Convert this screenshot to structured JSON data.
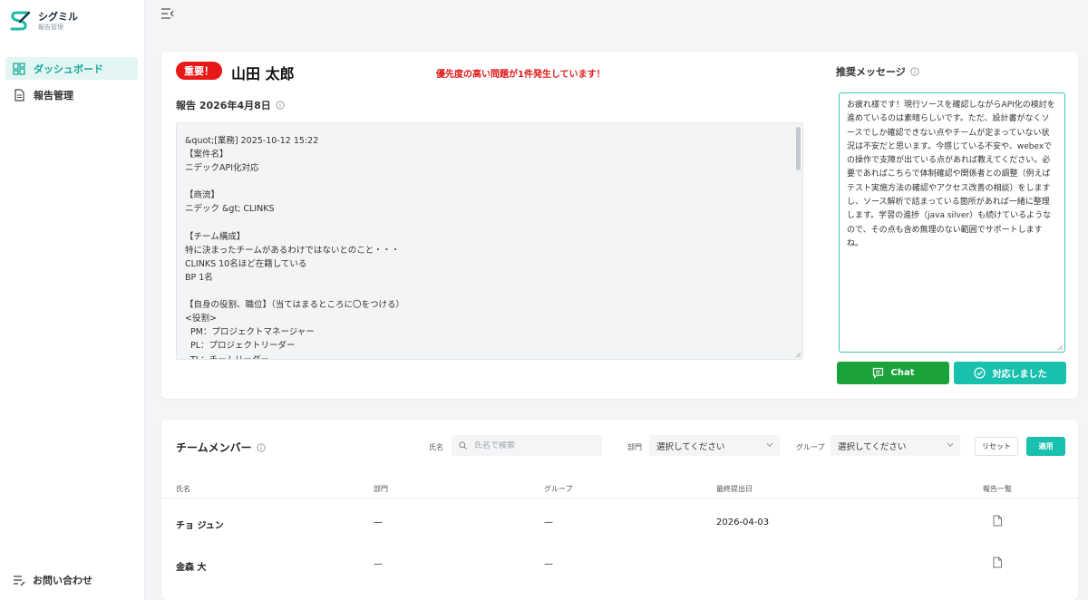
{
  "brand": {
    "name": "シグミル",
    "sub": "報告管理"
  },
  "sidebar": {
    "items": [
      {
        "label": "ダッシュボード",
        "icon": "dashboard-icon",
        "active": true
      },
      {
        "label": "報告管理",
        "icon": "document-icon",
        "active": false
      }
    ],
    "footer": {
      "label": "お問い合わせ",
      "icon": "contact-icon"
    }
  },
  "report": {
    "badge": "重要！",
    "person": "山田 太郎",
    "alert": "優先度の高い問題が1件発生しています！",
    "heading": "報告 2026年4月8日",
    "content": "&quot;[業務] 2025-10-12 15:22\n【案件名】\nニデックAPI化対応\n\n【商流】\nニデック &gt; CLINKS\n\n【チーム構成】\n特に決まったチームがあるわけではないとのこと・・・\nCLINKS 10名ほど在籍している\nBP 1名\n\n【自身の役割、職位】（当てはまるところに〇をつける）\n<役割>\n  PM：プロジェクトマネージャー\n  PL：プロジェクトリーダー\n  TL：チームリーダー"
  },
  "recommendation": {
    "heading": "推奨メッセージ",
    "text": "お疲れ様です！現行ソースを確認しながらAPI化の検討を進めているのは素晴らしいです。ただ、設計書がなくソースでしか確認できない点やチームが定まっていない状況は不安だと思います。今感じている不安や、webexでの操作で支障が出ている点があれば教えてください。必要であればこちらで体制確認や関係者との調整（例えばテスト実施方法の確認やアクセス改善の相談）をしますし、ソース解析で詰まっている箇所があれば一緒に整理します。学習の進捗（java silver）も続けているようなので、その点も含め無理のない範囲でサポートしますね。",
    "chat_label": "Chat",
    "done_label": "対応しました"
  },
  "team": {
    "heading": "チームメンバー",
    "filters": {
      "name_label": "氏名",
      "name_placeholder": "氏名で検索",
      "dept_label": "部門",
      "dept_value": "選択してください",
      "group_label": "グループ",
      "group_value": "選択してください",
      "reset_label": "リセット",
      "apply_label": "適用"
    },
    "columns": [
      "氏名",
      "部門",
      "グループ",
      "最終提出日",
      "報告一覧"
    ],
    "rows": [
      {
        "name": "チョ ジュン",
        "dept": "—",
        "group": "—",
        "last": "2026-04-03"
      },
      {
        "name": "金森 大",
        "dept": "—",
        "group": "—",
        "last": ""
      }
    ]
  },
  "colors": {
    "accent": "#19c0ae",
    "chat": "#1aa33a",
    "alert": "#e01a1a",
    "badge": "#e81818"
  }
}
